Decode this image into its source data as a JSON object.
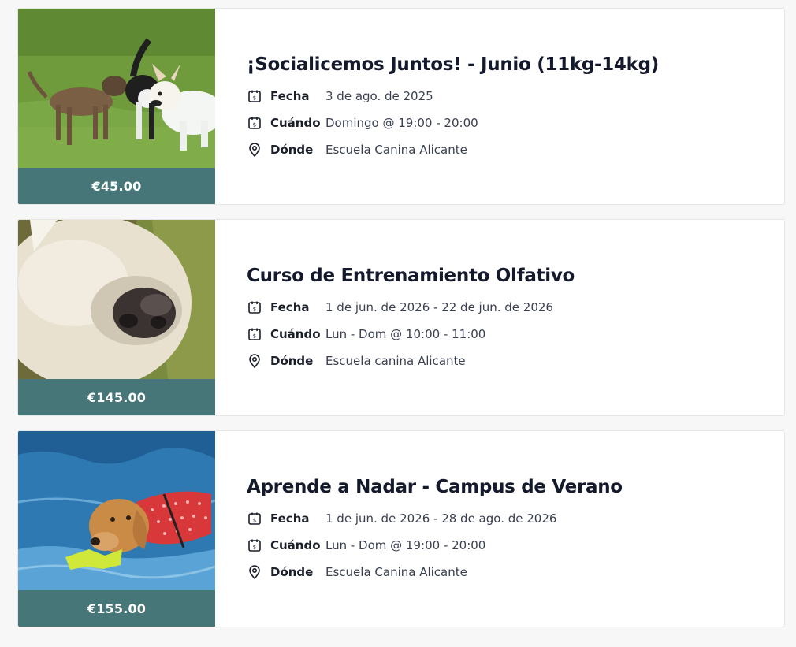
{
  "theme": {
    "price_band_color": "#467677"
  },
  "events": [
    {
      "title": "¡Socialicemos Juntos! - Junio (11kg-14kg)",
      "price": "€45.00",
      "fecha_label": "Fecha",
      "fecha": "3 de ago. de 2025",
      "cuando_label": "Cuándo",
      "cuando": "Domingo @ 19:00 - 20:00",
      "donde_label": "Dónde",
      "donde": "Escuela Canina Alicante",
      "image_icon": "dogs-playing-photo"
    },
    {
      "title": "Curso de Entrenamiento Olfativo",
      "price": "€145.00",
      "fecha_label": "Fecha",
      "fecha": "1 de jun. de 2026 - 22 de jun. de 2026",
      "cuando_label": "Cuándo",
      "cuando": "Lun - Dom @ 10:00 - 11:00",
      "donde_label": "Dónde",
      "donde": "Escuela canina Alicante",
      "image_icon": "dog-nose-photo"
    },
    {
      "title": "Aprende a Nadar - Campus de Verano",
      "price": "€155.00",
      "fecha_label": "Fecha",
      "fecha": "1 de jun. de 2026 - 28 de ago. de 2026",
      "cuando_label": "Cuándo",
      "cuando": "Lun - Dom @ 19:00 - 20:00",
      "donde_label": "Dónde",
      "donde": "Escuela Canina Alicante",
      "image_icon": "dog-swimming-photo"
    }
  ],
  "icons": {
    "date": "calendar-dollar-icon",
    "when": "calendar-dollar-icon",
    "where": "location-pin-icon"
  }
}
